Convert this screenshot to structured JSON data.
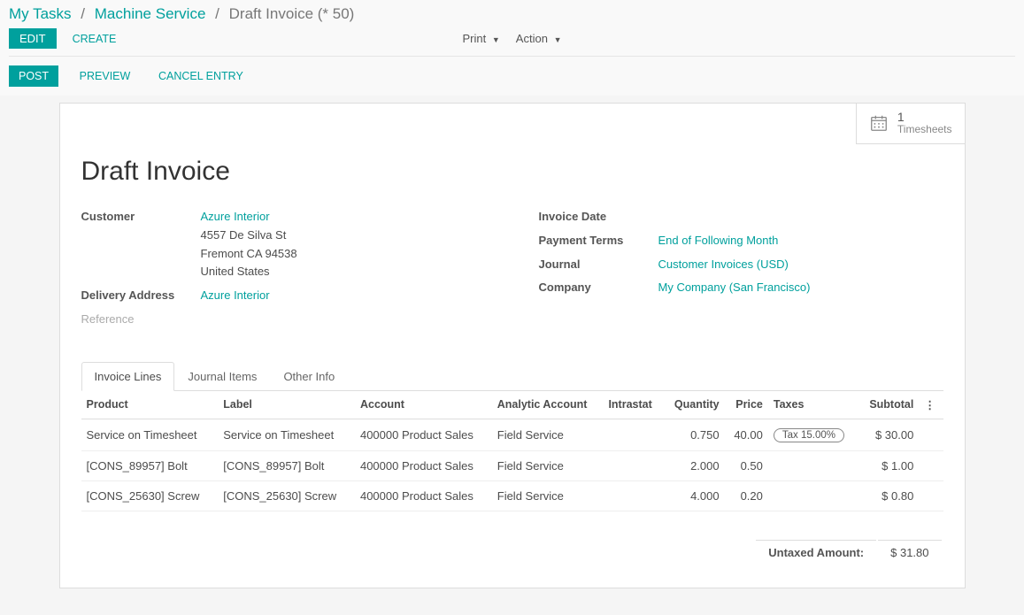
{
  "breadcrumb": {
    "items": [
      {
        "label": "My Tasks"
      },
      {
        "label": "Machine Service"
      }
    ],
    "current": "Draft Invoice (* 50)"
  },
  "toolbar": {
    "edit": "EDIT",
    "create": "CREATE",
    "print": "Print",
    "action": "Action"
  },
  "statusbar": {
    "post": "POST",
    "preview": "PREVIEW",
    "cancel_entry": "CANCEL ENTRY"
  },
  "stat_button": {
    "count": "1",
    "label": "Timesheets"
  },
  "title": "Draft Invoice",
  "left_fields": {
    "customer_label": "Customer",
    "customer_name": "Azure Interior",
    "addr_street": "4557 De Silva St",
    "addr_city": "Fremont CA 94538",
    "addr_country": "United States",
    "delivery_label": "Delivery Address",
    "delivery_value": "Azure Interior",
    "reference_label": "Reference"
  },
  "right_fields": {
    "invoice_date_label": "Invoice Date",
    "payment_terms_label": "Payment Terms",
    "payment_terms_value": "End of Following Month",
    "journal_label": "Journal",
    "journal_value": "Customer Invoices (USD)",
    "company_label": "Company",
    "company_value": "My Company (San Francisco)"
  },
  "tabs": {
    "invoice_lines": "Invoice Lines",
    "journal_items": "Journal Items",
    "other_info": "Other Info"
  },
  "table": {
    "heads": {
      "product": "Product",
      "label": "Label",
      "account": "Account",
      "analytic": "Analytic Account",
      "intrastat": "Intrastat",
      "quantity": "Quantity",
      "price": "Price",
      "taxes": "Taxes",
      "subtotal": "Subtotal"
    },
    "rows": [
      {
        "product": "Service on Timesheet",
        "label": "Service on Timesheet",
        "account": "400000 Product Sales",
        "analytic": "Field Service",
        "intrastat": "",
        "quantity": "0.750",
        "price": "40.00",
        "taxes": "Tax 15.00%",
        "subtotal": "$ 30.00"
      },
      {
        "product": "[CONS_89957] Bolt",
        "label": "[CONS_89957] Bolt",
        "account": "400000 Product Sales",
        "analytic": "Field Service",
        "intrastat": "",
        "quantity": "2.000",
        "price": "0.50",
        "taxes": "",
        "subtotal": "$ 1.00"
      },
      {
        "product": "[CONS_25630] Screw",
        "label": "[CONS_25630] Screw",
        "account": "400000 Product Sales",
        "analytic": "Field Service",
        "intrastat": "",
        "quantity": "4.000",
        "price": "0.20",
        "taxes": "",
        "subtotal": "$ 0.80"
      }
    ]
  },
  "totals": {
    "untaxed_label": "Untaxed Amount:",
    "untaxed_value": "$ 31.80"
  }
}
